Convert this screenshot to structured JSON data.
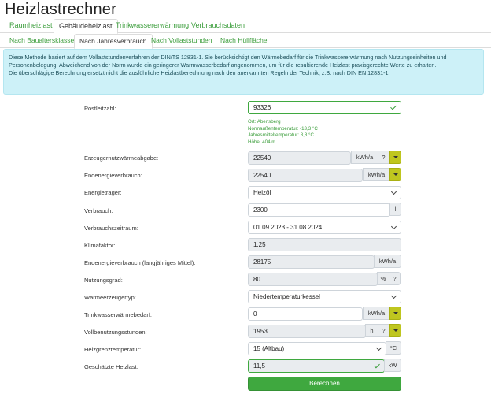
{
  "page_title": "Heizlastrechner",
  "main_tabs": [
    "Raumheizlast",
    "Gebäudeheizlast",
    "Trinkwassererwärmung",
    "Verbrauchsdaten"
  ],
  "sub_tabs": [
    "Nach Baualtersklasse",
    "Nach Jahresverbrauch",
    "Nach Vollaststunden",
    "Nach Hüllfläche"
  ],
  "info": {
    "p1": "Diese Methode basiert auf dem Vollaststundenverfahren der DIN/TS 12831-1. Sie berücksichtigt den Wärmebedarf für die Trinkwassererwärmung nach Nutzungseinheiten und Personenbelegung. Abweichend von der Norm wurde ein geringerer Warmwasserbedarf angenommen, um für die resultierende Heizlast praxisgerechte Werte zu erhalten.",
    "p2": "Die überschlägige Berechnung ersetzt nicht die ausführliche Heizlastberechnung nach den anerkannten Regeln der Technik, z.B. nach DIN EN 12831-1."
  },
  "plz": {
    "label": "Postleitzahl:",
    "value": "93326"
  },
  "location": {
    "ort": "Ort: Abensberg",
    "norm": "Normaußentemperatur: -13,3 °C",
    "jahresmittel": "Jahresmitteltemperatur: 8,8 °C",
    "hoehe": "Höhe: 404 m"
  },
  "erzeuger": {
    "label": "Erzeugernutzwärmeabgabe:",
    "value": "22540",
    "unit": "kWh/a",
    "help": "?"
  },
  "endenergie": {
    "label": "Endenergieverbrauch:",
    "value": "22540",
    "unit": "kWh/a"
  },
  "energietraeger": {
    "label": "Energieträger:",
    "value": "Heizöl"
  },
  "verbrauch": {
    "label": "Verbrauch:",
    "value": "2300",
    "unit": "l"
  },
  "zeitraum": {
    "label": "Verbrauchszeitraum:",
    "value": "01.09.2023 - 31.08.2024"
  },
  "klima": {
    "label": "Klimafaktor:",
    "value": "1,25"
  },
  "endenergie_mittel": {
    "label": "Endenergieverbrauch (langjähriges Mittel):",
    "value": "28175",
    "unit": "kWh/a"
  },
  "nutzungsgrad": {
    "label": "Nutzungsgrad:",
    "value": "80",
    "unit": "%",
    "help": "?"
  },
  "waermeerzeuger": {
    "label": "Wärmeerzeugertyp:",
    "value": "Niedertemperaturkessel"
  },
  "trinkwasser": {
    "label": "Trinkwasserwärmebedarf:",
    "value": "0",
    "unit": "kWh/a"
  },
  "vollbenutzung": {
    "label": "Vollbenutzungsstunden:",
    "value": "1953",
    "unit": "h",
    "help": "?"
  },
  "heizgrenz": {
    "label": "Heizgrenztemperatur:",
    "value": "15 (Altbau)",
    "unit": "°C"
  },
  "heizlast": {
    "label": "Geschätzte Heizlast:",
    "value": "11,5",
    "unit": "kW"
  },
  "button": "Berechnen"
}
